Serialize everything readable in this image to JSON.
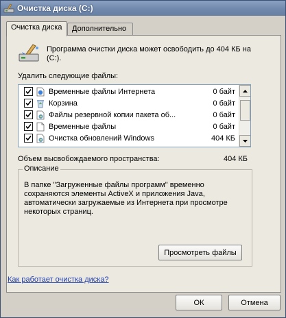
{
  "window": {
    "title": "Очистка диска  (C:)"
  },
  "tabs": [
    {
      "label": "Очистка диска"
    },
    {
      "label": "Дополнительно"
    }
  ],
  "header": {
    "text": "Программа очистки диска может освободить до 404 КБ на  (C:)."
  },
  "files": {
    "label": "Удалить следующие файлы:",
    "items": [
      {
        "name": "Временные файлы Интернета",
        "size": "0 байт",
        "checked": true,
        "icon": "internet-files-icon"
      },
      {
        "name": "Корзина",
        "size": "0 байт",
        "checked": true,
        "icon": "recycle-bin-icon"
      },
      {
        "name": "Файлы резервной копии пакета об...",
        "size": "0 байт",
        "checked": true,
        "icon": "backup-files-icon"
      },
      {
        "name": "Временные файлы",
        "size": "0 байт",
        "checked": true,
        "icon": "temp-files-icon"
      },
      {
        "name": "Очистка обновлений Windows",
        "size": "404 КБ",
        "checked": true,
        "icon": "windows-update-icon"
      }
    ]
  },
  "space": {
    "label": "Объем высвобождаемого пространства:",
    "value": "404 КБ"
  },
  "description": {
    "title": "Описание",
    "text": "В папке \"Загруженные файлы программ\" временно сохраняются элементы ActiveX и приложения Java, автоматически загружаемые из Интернета при просмотре некоторых страниц."
  },
  "buttons": {
    "view": "Просмотреть файлы",
    "ok": "ОК",
    "cancel": "Отмена"
  },
  "help_link": "Как работает очистка диска?"
}
